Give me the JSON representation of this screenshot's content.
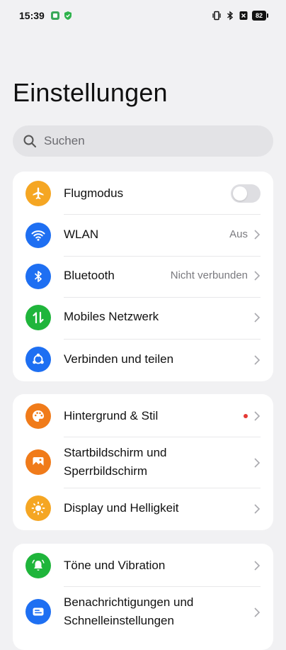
{
  "status": {
    "time": "15:39",
    "battery": "82"
  },
  "title": "Einstellungen",
  "search": {
    "placeholder": "Suchen"
  },
  "groups": [
    {
      "items": [
        {
          "label": "Flugmodus",
          "icon": "airplane-icon",
          "color": "#f5a623",
          "control": "toggle",
          "toggle_on": false
        },
        {
          "label": "WLAN",
          "icon": "wifi-icon",
          "color": "#1e6ff2",
          "value": "Aus"
        },
        {
          "label": "Bluetooth",
          "icon": "bluetooth-icon",
          "color": "#1e6ff2",
          "value": "Nicht verbunden"
        },
        {
          "label": "Mobiles Netzwerk",
          "icon": "mobile-data-icon",
          "color": "#1fb53b"
        },
        {
          "label": "Verbinden und teilen",
          "icon": "share-icon",
          "color": "#1e6ff2"
        }
      ]
    },
    {
      "items": [
        {
          "label": "Hintergrund & Stil",
          "icon": "palette-icon",
          "color": "#f07b1a",
          "badge": "dot"
        },
        {
          "label": "Startbildschirm und Sperrbildschirm",
          "label_line1": "Startbildschirm und",
          "label_line2": "Sperrbildschirm",
          "icon": "wallpaper-icon",
          "color": "#f07b1a"
        },
        {
          "label": "Display und Helligkeit",
          "icon": "brightness-icon",
          "color": "#f5a623"
        }
      ]
    },
    {
      "items": [
        {
          "label": "Töne und Vibration",
          "icon": "bell-icon",
          "color": "#1fb53b"
        },
        {
          "label": "Benachrichtigungen und Schnelleinstellungen",
          "label_line1": "Benachrichtigungen und",
          "label_line2": "Schnelleinstellungen",
          "icon": "notification-icon",
          "color": "#1e6ff2"
        }
      ]
    }
  ]
}
